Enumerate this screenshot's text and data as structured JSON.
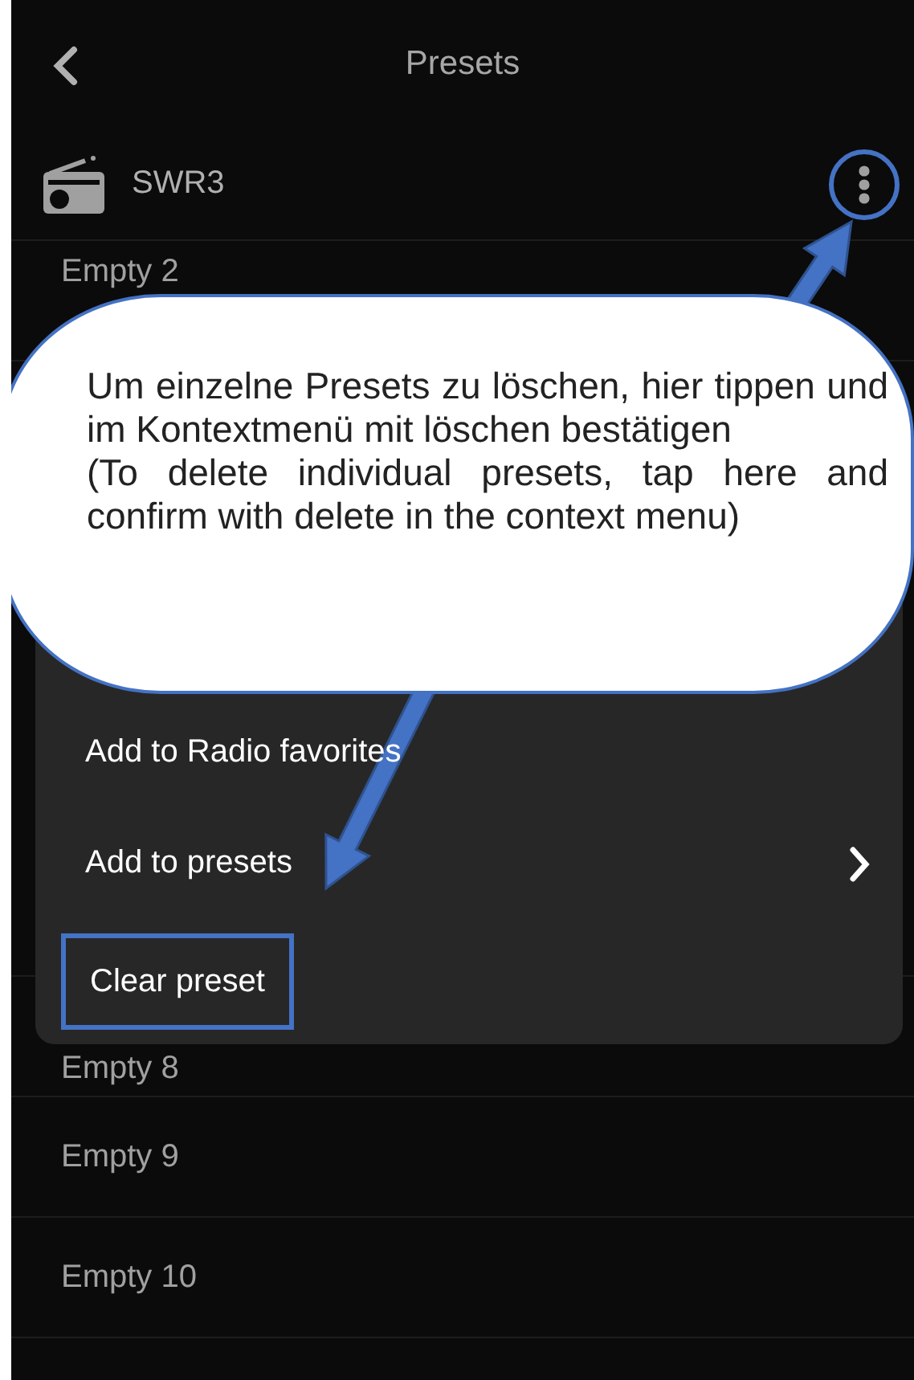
{
  "header": {
    "title": "Presets"
  },
  "station": {
    "name": "SWR3",
    "more_highlighted": true
  },
  "presets": [
    {
      "label": "Empty 2"
    },
    {
      "label": "Empty 8"
    },
    {
      "label": "Empty 9"
    },
    {
      "label": "Empty 10"
    }
  ],
  "context_menu": {
    "items": [
      {
        "label": "Add to Radio favorites",
        "kind": "plain",
        "highlighted": false
      },
      {
        "label": "Add to presets",
        "kind": "submenu",
        "highlighted": false
      },
      {
        "label": "Clear preset",
        "kind": "plain",
        "highlighted": true
      }
    ]
  },
  "callout": {
    "paragraphs": [
      "Um einzelne Presets zu löschen, hier tippen und im Kontextmenü mit löschen bestätigen",
      "(To delete individual presets, tap here and confirm with delete in the context menu)"
    ]
  }
}
